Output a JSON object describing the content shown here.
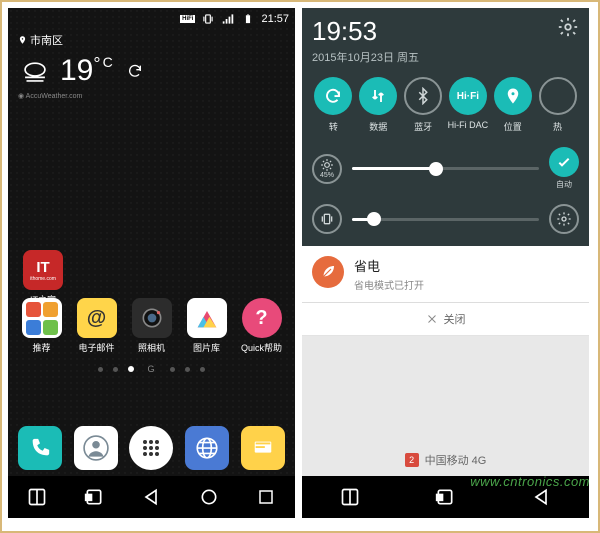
{
  "left": {
    "status": {
      "time": "21:57",
      "hifi": "HiFi"
    },
    "location": "市南区",
    "weather": {
      "temp": "19",
      "unit": "°",
      "scale": "C",
      "provider": "AccuWeather.com"
    },
    "single_app": {
      "name": "IT之家",
      "sub": "ithome.com",
      "badge": "IT"
    },
    "row_apps": [
      {
        "name": "推荐"
      },
      {
        "name": "电子邮件"
      },
      {
        "name": "照相机"
      },
      {
        "name": "图片库"
      },
      {
        "name": "Quick帮助"
      }
    ],
    "page_indicator_label": "G",
    "dock": [
      "phone",
      "contacts",
      "apps",
      "browser",
      "messages"
    ]
  },
  "right": {
    "time": "19:53",
    "date": "2015年10月23日 周五",
    "qs": [
      {
        "label": "转",
        "on": true
      },
      {
        "label": "数据",
        "on": true
      },
      {
        "label": "蓝牙",
        "on": false
      },
      {
        "label": "Hi-Fi DAC",
        "on": true,
        "text": "Hi·Fi"
      },
      {
        "label": "位置",
        "on": true
      },
      {
        "label": "热",
        "on": false
      }
    ],
    "brightness": {
      "pct_label": "45%",
      "value": 45,
      "auto_label": "自动"
    },
    "volume": {
      "value": 12
    },
    "notif": {
      "title": "省电",
      "sub": "省电模式已打开",
      "close": "关闭"
    },
    "carrier": {
      "sim": "2",
      "name": "中国移动 4G"
    }
  },
  "watermark": "www.cntronics.com"
}
